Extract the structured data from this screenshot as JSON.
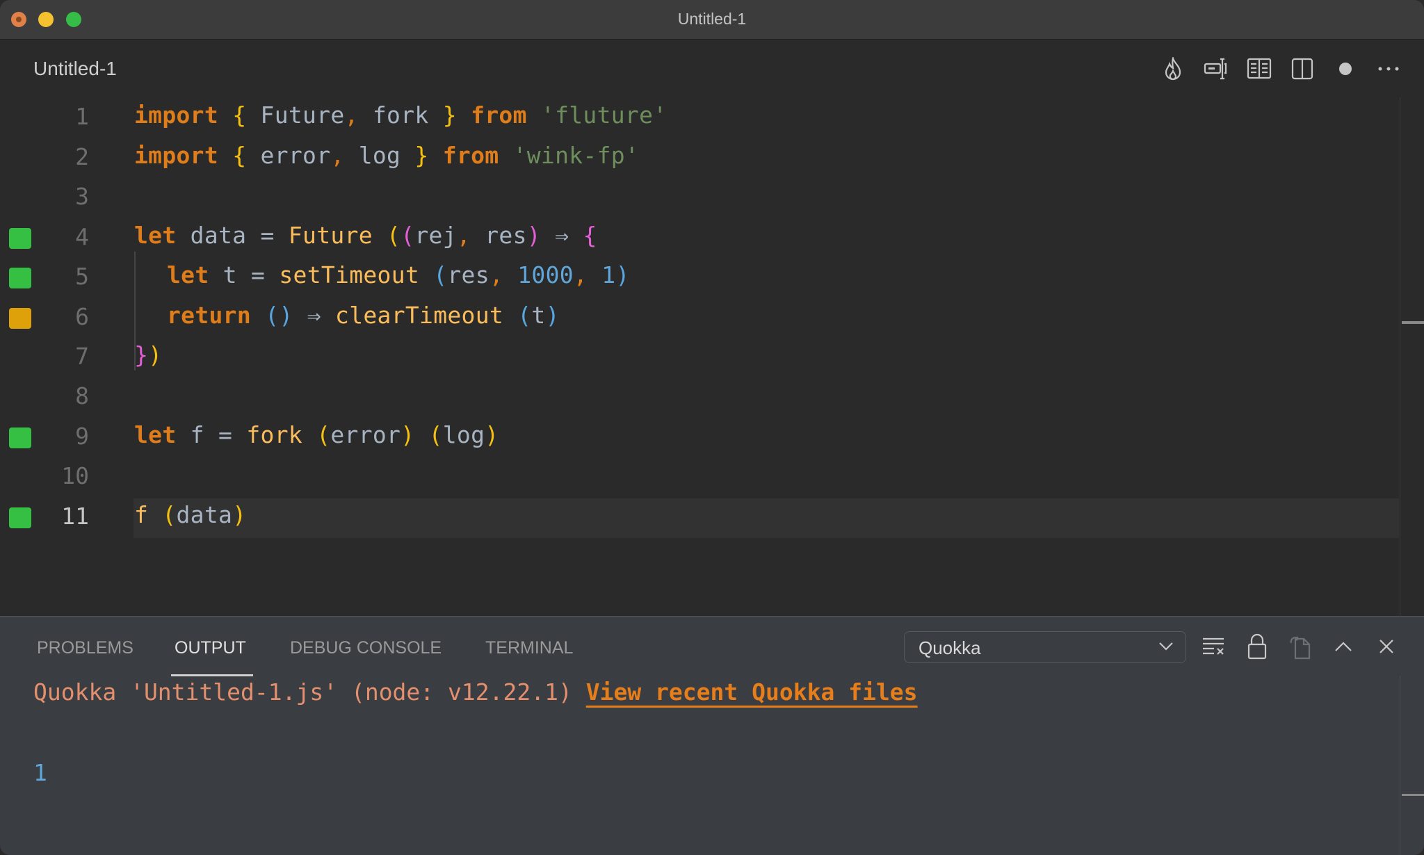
{
  "window": {
    "title": "Untitled-1",
    "traffic_lights": [
      "close",
      "minimize",
      "maximize"
    ]
  },
  "editor_tab": {
    "title": "Untitled-1",
    "actions": [
      {
        "name": "quokka-flame-icon"
      },
      {
        "name": "inline-rename-icon"
      },
      {
        "name": "open-preview-icon"
      },
      {
        "name": "split-editor-icon"
      },
      {
        "name": "unsaved-dot-icon"
      },
      {
        "name": "more-actions-icon"
      }
    ]
  },
  "code": {
    "lines": [
      {
        "n": "1",
        "marker": null
      },
      {
        "n": "2",
        "marker": null
      },
      {
        "n": "3",
        "marker": null
      },
      {
        "n": "4",
        "marker": "green"
      },
      {
        "n": "5",
        "marker": "green"
      },
      {
        "n": "6",
        "marker": "yellow"
      },
      {
        "n": "7",
        "marker": null
      },
      {
        "n": "8",
        "marker": null
      },
      {
        "n": "9",
        "marker": "green"
      },
      {
        "n": "10",
        "marker": null
      },
      {
        "n": "11",
        "marker": "green"
      }
    ],
    "tokens": {
      "l1": [
        "import",
        " ",
        "{",
        " Future",
        ",",
        " fork ",
        "}",
        " ",
        "from",
        " ",
        "'fluture'"
      ],
      "l2": [
        "import",
        " ",
        "{",
        " error",
        ",",
        " log ",
        "}",
        " ",
        "from",
        " ",
        "'wink-fp'"
      ],
      "l4": [
        "let",
        " data = ",
        "Future",
        " ",
        "(",
        "(",
        "rej",
        ",",
        " res",
        ")",
        " ⇒ ",
        "{"
      ],
      "l5": [
        "let",
        " t = ",
        "setTimeout",
        " ",
        "(",
        "res",
        ",",
        " ",
        "1000",
        ",",
        " ",
        "1",
        ")"
      ],
      "l6": [
        "return",
        " ",
        "()",
        " ⇒ ",
        "clearTimeout",
        " ",
        "(",
        "t",
        ")"
      ],
      "l7": [
        "}",
        ")"
      ],
      "l9": [
        "let",
        " f = ",
        "fork",
        " ",
        "(",
        "error",
        ")",
        " ",
        "(",
        "log",
        ")"
      ],
      "l11": [
        "f",
        " ",
        "(",
        "data",
        ")"
      ]
    },
    "current_line": "11"
  },
  "colors": {
    "marker_green": "#35c043",
    "marker_yellow": "#dfa10a",
    "keyword": "#e07d1b",
    "function": "#fbbc5c",
    "string": "#6e8f5d",
    "number": "#60a6d8"
  },
  "panel": {
    "tabs": [
      {
        "label": "PROBLEMS",
        "active": false
      },
      {
        "label": "OUTPUT",
        "active": true
      },
      {
        "label": "DEBUG CONSOLE",
        "active": false
      },
      {
        "label": "TERMINAL",
        "active": false
      }
    ],
    "channel": "Quokka",
    "tools": [
      "clear-output-icon",
      "lock-scroll-icon",
      "open-log-file-icon",
      "maximize-panel-icon",
      "close-panel-icon"
    ],
    "output": {
      "info": "Quokka 'Untitled-1.js' (node: v12.22.1) ",
      "link": "View recent Quokka files",
      "value": "1"
    }
  }
}
